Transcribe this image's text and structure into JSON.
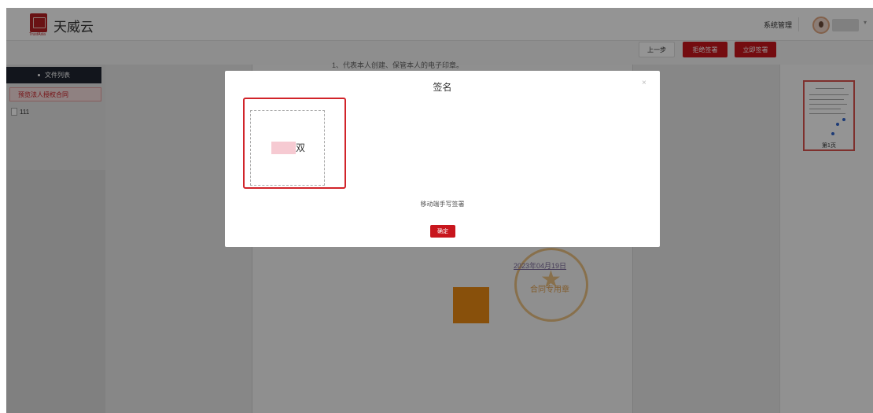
{
  "header": {
    "app_title": "天威云",
    "logo_subtitle": "TrustAsia",
    "system_manage": "系统管理",
    "user_caret": "▾"
  },
  "toolbar": {
    "prev_label": "上一步",
    "reject_label": "拒绝签署",
    "sign_now_label": "立即签署"
  },
  "sidebar": {
    "title": "文件列表",
    "items": [
      {
        "label": "预览法人授权合同"
      },
      {
        "label": "111"
      }
    ]
  },
  "document": {
    "visible_text": "1、代表本人创建、保管本人的电子印章。",
    "seal_date": "2023年04月19日",
    "seal_text": "合同专用章"
  },
  "thumbnail": {
    "page_label": "第1页"
  },
  "modal": {
    "title": "签名",
    "close_glyph": "×",
    "signature_char": "双",
    "hint": "移动端手写签署",
    "confirm_label": "确定"
  },
  "colors": {
    "accent": "#c8161d",
    "sidebar_dark": "#1f2531",
    "seal_orange": "#e8b870"
  }
}
